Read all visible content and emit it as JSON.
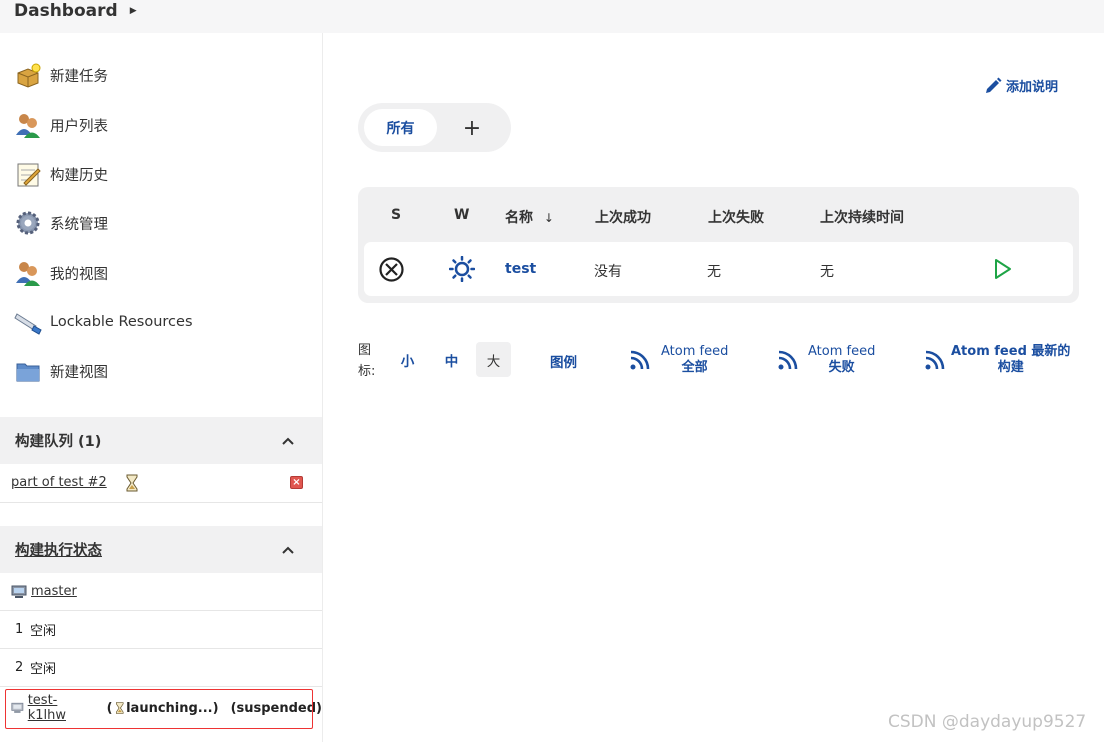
{
  "header": {
    "breadcrumb_root": "Dashboard"
  },
  "sidebar": {
    "tasks": [
      {
        "label": "新建任务",
        "icon": "new-item-icon"
      },
      {
        "label": "用户列表",
        "icon": "people-icon"
      },
      {
        "label": "构建历史",
        "icon": "notepad-icon"
      },
      {
        "label": "系统管理",
        "icon": "gear-icon"
      },
      {
        "label": "我的视图",
        "icon": "user-icon"
      },
      {
        "label": "Lockable Resources",
        "icon": "lock-resource-icon"
      },
      {
        "label": "新建视图",
        "icon": "folder-icon"
      }
    ],
    "build_queue": {
      "title": "构建队列 (1)",
      "items": [
        {
          "name": "part of test #2"
        }
      ]
    },
    "executors": {
      "title": "构建执行状态",
      "master": "master",
      "rows": [
        {
          "num": "1",
          "status": "空闲"
        },
        {
          "num": "2",
          "status": "空闲"
        }
      ],
      "agent": {
        "name": "test-k1lhw",
        "paren_open": "(",
        "state": "launching...)",
        "suspended": "(suspended)"
      }
    }
  },
  "main": {
    "add_description": "添加说明",
    "tabs": {
      "all": "所有",
      "add": "+"
    },
    "table": {
      "headers": {
        "s": "S",
        "w": "W",
        "name": "名称",
        "name_sort": "↓",
        "last_success": "上次成功",
        "last_failure": "上次失败",
        "last_duration": "上次持续时间"
      },
      "rows": [
        {
          "name": "test",
          "last_success": "没有",
          "last_failure": "无",
          "last_duration": "无"
        }
      ]
    },
    "icon_size": {
      "label": "图标:",
      "small": "小",
      "medium": "中",
      "large": "大"
    },
    "legend": "图例",
    "feeds": [
      {
        "line1": "Atom feed",
        "line2": "全部"
      },
      {
        "line1": "Atom feed",
        "line2": "失败"
      },
      {
        "line1": "Atom feed 最新的",
        "line2": "构建"
      }
    ]
  },
  "watermark": "CSDN @daydayup9527",
  "colors": {
    "link": "#1b4ea0",
    "run_green": "#1ea446",
    "agent_box_border": "#ee3333"
  }
}
